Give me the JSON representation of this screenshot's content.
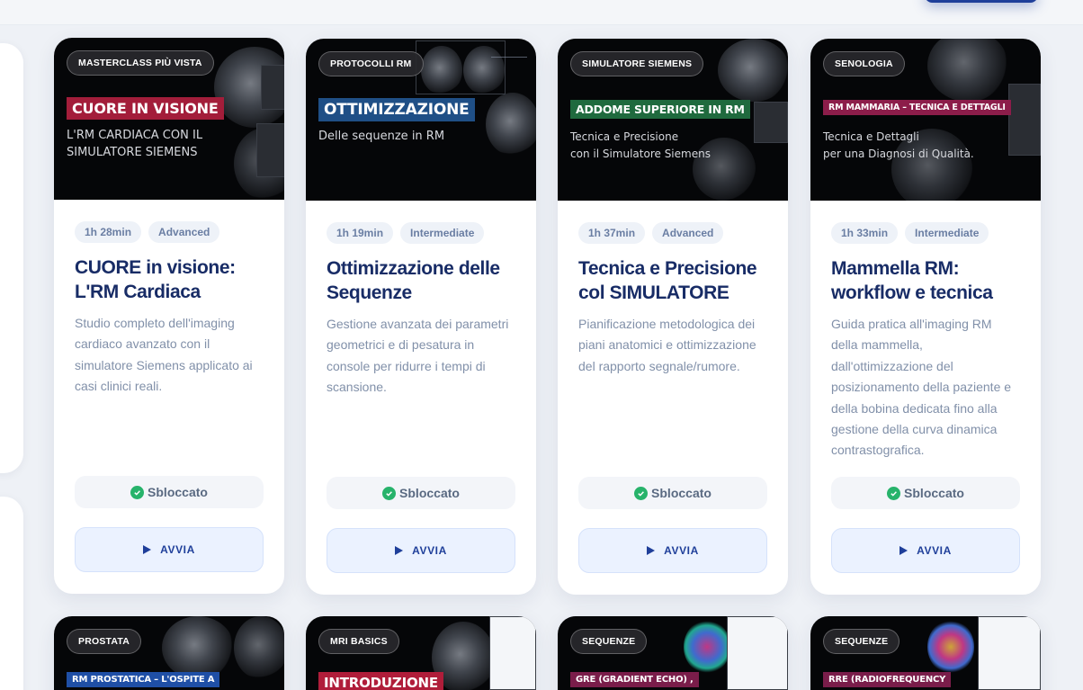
{
  "cards": [
    {
      "category": "MASTERCLASS PIÙ VISTA",
      "banner": "CUORE IN VISIONE",
      "banner_color": "#a31d3a",
      "subtitle": "L'RM CARDIACA CON IL\nSIMULATORE SIEMENS",
      "duration": "1h 28min",
      "level": "Advanced",
      "title": "CUORE in visione: L'RM Cardiaca",
      "description": "Studio completo dell'imaging cardiaco avanzato con il simulatore Siemens applicato ai casi clinici reali.",
      "status": "Sbloccato",
      "action": "AVVIA"
    },
    {
      "category": "PROTOCOLLI RM",
      "banner": "OTTIMIZZAZIONE",
      "banner_color": "#1f4f86",
      "subtitle": "Delle sequenze in RM",
      "duration": "1h 19min",
      "level": "Intermediate",
      "title": "Ottimizzazione delle Sequenze",
      "description": "Gestione avanzata dei parametri geometrici e di pesatura in console per ridurre i tempi di scansione.",
      "status": "Sbloccato",
      "action": "AVVIA"
    },
    {
      "category": "SIMULATORE SIEMENS",
      "banner": "ADDOME SUPERIORE IN RM",
      "banner_color": "#1f6a3e",
      "subtitle": "Tecnica e Precisione\ncon il Simulatore Siemens",
      "duration": "1h 37min",
      "level": "Advanced",
      "title": "Tecnica e Precisione col SIMULATORE",
      "description": "Pianificazione metodologica dei piani anatomici e ottimizzazione del rapporto segnale/rumore.",
      "status": "Sbloccato",
      "action": "AVVIA"
    },
    {
      "category": "SENOLOGIA",
      "banner": "RM MAMMARIA – TECNICA E DETTAGLI",
      "banner_color": "#8c1d4a",
      "subtitle": "Tecnica e Dettagli\nper una Diagnosi di Qualità.",
      "duration": "1h 33min",
      "level": "Intermediate",
      "title": "Mammella RM: workflow e tecnica",
      "description": "Guida pratica all'imaging RM della mammella, dall'ottimizzazione del posizionamento della paziente e della bobina dedicata fino alla gestione della curva dinamica contrastografica.",
      "status": "Sbloccato",
      "action": "AVVIA"
    },
    {
      "category": "PROSTATA",
      "banner": "RM PROSTATICA – L'OSPITE A",
      "banner_color": "#1f4fa6"
    },
    {
      "category": "MRI BASICS",
      "banner": "INTRODUZIONE",
      "banner_color": "#b01d3a"
    },
    {
      "category": "SEQUENZE",
      "banner": "GRE (GRADIENT ECHO) ,",
      "banner_color": "#7a1d4a"
    },
    {
      "category": "SEQUENZE",
      "banner": "RRE (RADIOFREQUENCY",
      "banner_color": "#7a1d4a"
    }
  ]
}
